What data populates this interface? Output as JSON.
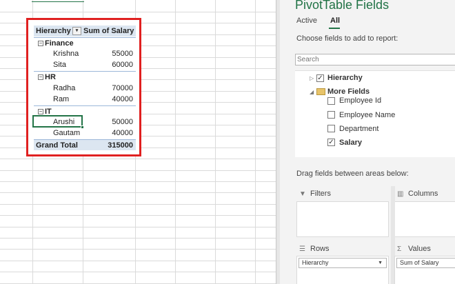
{
  "pivot_table": {
    "header_row_label": "Hierarchy",
    "header_value_label": "Sum of Salary",
    "filter_icon": "filter-dropdown-icon",
    "groups": [
      {
        "name": "Finance",
        "items": [
          {
            "name": "Krishna",
            "value": "55000"
          },
          {
            "name": "Sita",
            "value": "60000"
          }
        ]
      },
      {
        "name": "HR",
        "items": [
          {
            "name": "Radha",
            "value": "70000"
          },
          {
            "name": "Ram",
            "value": "40000"
          }
        ]
      },
      {
        "name": "IT",
        "items": [
          {
            "name": "Arushi",
            "value": "50000"
          },
          {
            "name": "Gautam",
            "value": "40000"
          }
        ]
      }
    ],
    "grand_total_label": "Grand Total",
    "grand_total_value": "315000",
    "highlight_color": "#e02020",
    "header_fill": "#dce6f1"
  },
  "task_pane": {
    "title": "PivotTable Fields",
    "tabs": [
      {
        "label": "Active",
        "selected": false
      },
      {
        "label": "All",
        "selected": true
      }
    ],
    "choose_label": "Choose fields to add to report:",
    "search_placeholder": "Search",
    "fields": {
      "hierarchy": {
        "label": "Hierarchy",
        "checked": true
      },
      "more_fields": "More Fields",
      "items": [
        {
          "label": "Employee Id",
          "checked": false
        },
        {
          "label": "Employee Name",
          "checked": false
        },
        {
          "label": "Department",
          "checked": false
        },
        {
          "label": "Salary",
          "checked": true
        }
      ]
    },
    "drag_label": "Drag fields between areas below:",
    "areas": {
      "filters": "Filters",
      "columns": "Columns",
      "rows": "Rows",
      "values": "Values",
      "rows_field": "Hierarchy",
      "values_field": "Sum of Salary"
    },
    "accent_color": "#217346"
  }
}
